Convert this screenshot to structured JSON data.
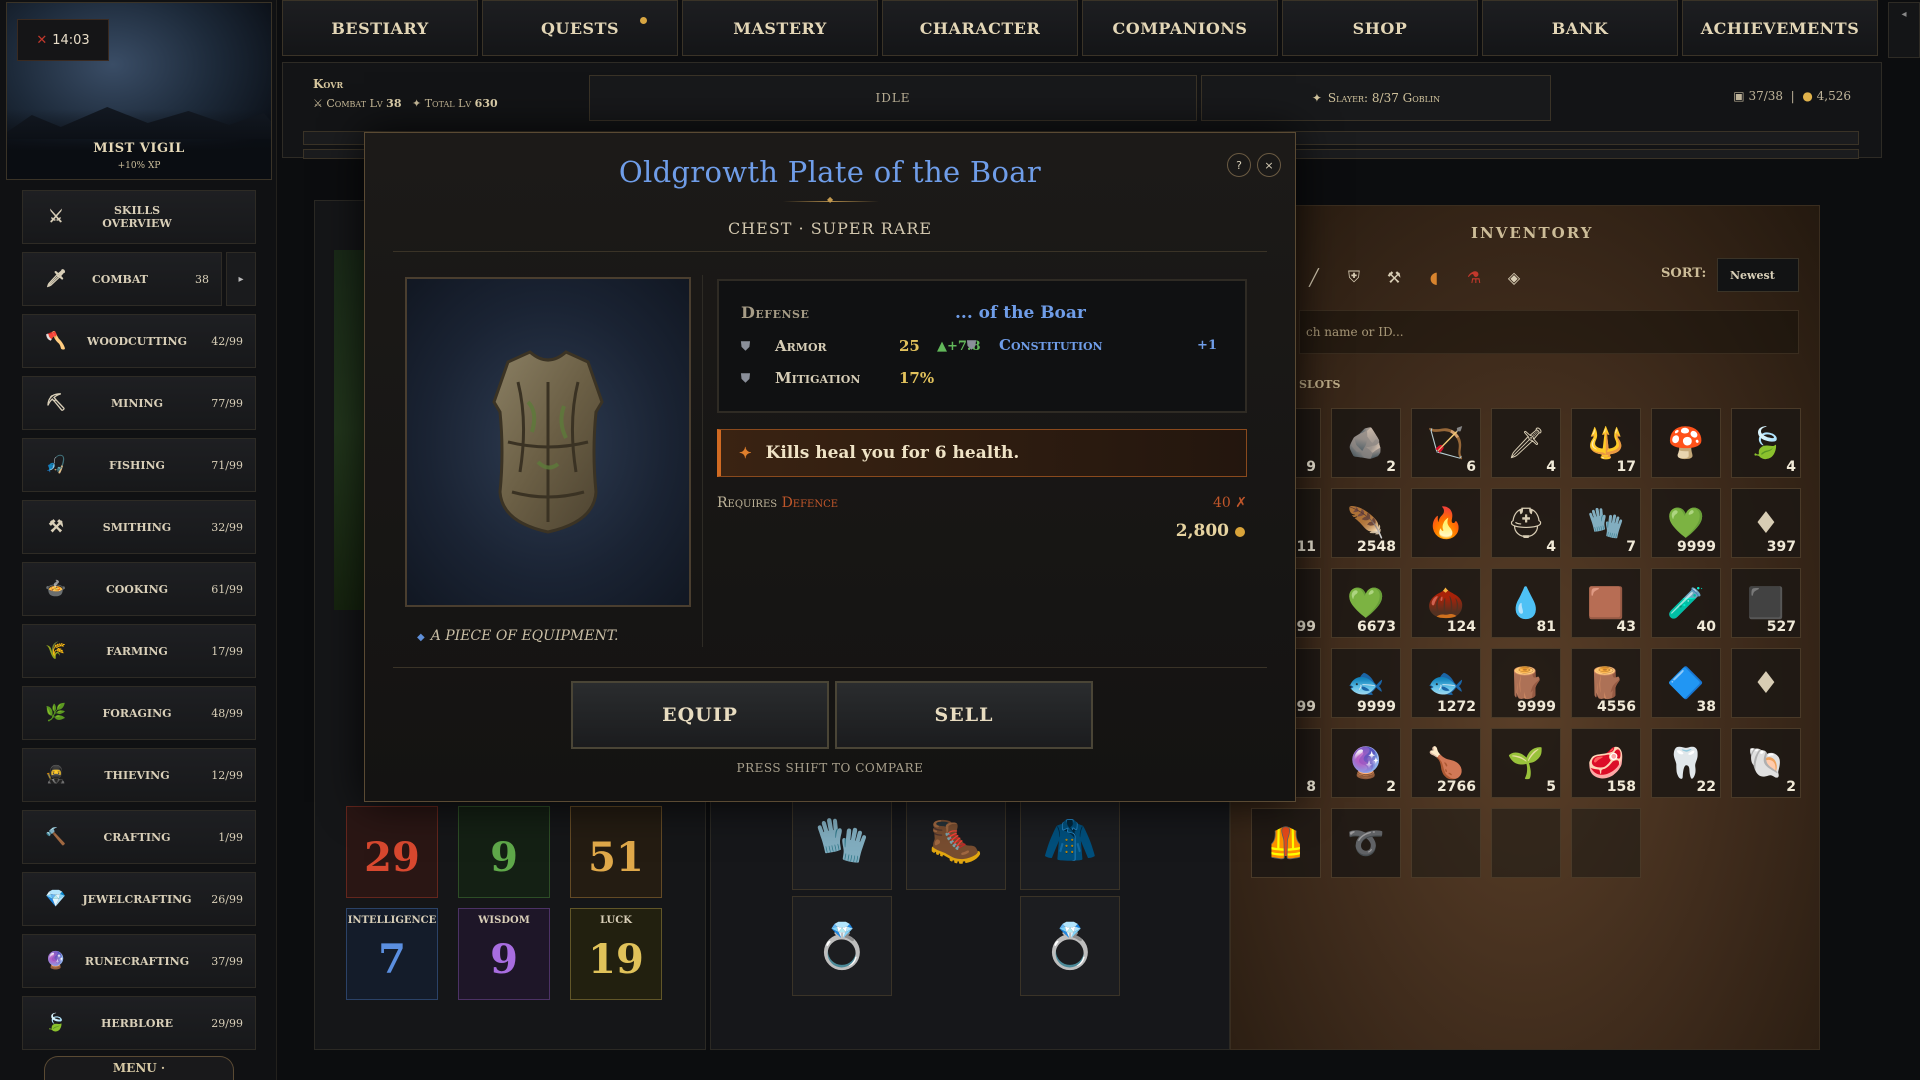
{
  "timer": {
    "value": "14:03"
  },
  "banner": {
    "title": "MIST VIGIL",
    "subtitle": "+10% XP"
  },
  "sidebar": {
    "items": [
      {
        "label": "SKILLS OVERVIEW",
        "level": "",
        "icon": "crossed-swords-icon",
        "glyph": "⚔"
      },
      {
        "label": "COMBAT",
        "level": "38",
        "icon": "sword-icon",
        "glyph": "🗡"
      },
      {
        "label": "WOODCUTTING",
        "level": "42/99",
        "icon": "axe-icon",
        "glyph": "🪓"
      },
      {
        "label": "MINING",
        "level": "77/99",
        "icon": "pickaxe-icon",
        "glyph": "⛏"
      },
      {
        "label": "FISHING",
        "level": "71/99",
        "icon": "fish-hook-icon",
        "glyph": "🎣"
      },
      {
        "label": "SMITHING",
        "level": "32/99",
        "icon": "anvil-icon",
        "glyph": "⚒"
      },
      {
        "label": "COOKING",
        "level": "61/99",
        "icon": "cooking-pot-icon",
        "glyph": "🍲"
      },
      {
        "label": "FARMING",
        "level": "17/99",
        "icon": "wheat-icon",
        "glyph": "🌾"
      },
      {
        "label": "FORAGING",
        "level": "48/99",
        "icon": "herb-icon",
        "glyph": "🌿"
      },
      {
        "label": "THIEVING",
        "level": "12/99",
        "icon": "hood-icon",
        "glyph": "🥷"
      },
      {
        "label": "CRAFTING",
        "level": "1/99",
        "icon": "hammer-icon",
        "glyph": "🔨"
      },
      {
        "label": "JEWELCRAFTING",
        "level": "26/99",
        "icon": "gem-icon",
        "glyph": "💎"
      },
      {
        "label": "RUNECRAFTING",
        "level": "37/99",
        "icon": "rune-icon",
        "glyph": "🔮"
      },
      {
        "label": "HERBLORE",
        "level": "29/99",
        "icon": "leaf-icon",
        "glyph": "🍃"
      }
    ],
    "combat_expand": "▸",
    "menu_label": "MENU ·"
  },
  "nav": {
    "tabs": [
      "BESTIARY",
      "QUESTS",
      "MASTERY",
      "CHARACTER",
      "COMPANIONS",
      "SHOP",
      "BANK",
      "ACHIEVEMENTS"
    ]
  },
  "status": {
    "player_name": "Kovr",
    "combat_label": "Combat Lv",
    "combat_level": "38",
    "total_label": "Total Lv",
    "total_level": "630",
    "activity": "IDLE",
    "slayer": "Slayer: 8/37 Goblin",
    "inv_count": "37/38",
    "gold": "4,526"
  },
  "stats": [
    {
      "label": "",
      "value": "29",
      "color": "#d8482f",
      "bg": "#2a1614"
    },
    {
      "label": "",
      "value": "9",
      "color": "#5fa84a",
      "bg": "#142014"
    },
    {
      "label": "",
      "value": "51",
      "color": "#e0a94a",
      "bg": "#241c12"
    },
    {
      "label": "INTELLIGENCE",
      "value": "7",
      "color": "#5b8fe0",
      "bg": "#141c2a"
    },
    {
      "label": "WISDOM",
      "value": "9",
      "color": "#a86de0",
      "bg": "#1e1628"
    },
    {
      "label": "LUCK",
      "value": "19",
      "color": "#e0c25a",
      "bg": "#22200f"
    }
  ],
  "inventory": {
    "title": "INVENTORY",
    "sort_label": "SORT:",
    "sort_value": "Newest",
    "search_placeholder": "ch name or ID...",
    "slots_label": "SLOTS",
    "items": [
      {
        "qty": "9",
        "icon": "partial-item-icon",
        "glyph": ""
      },
      {
        "qty": "2",
        "icon": "ore-cluster-icon",
        "glyph": "🪨"
      },
      {
        "qty": "6",
        "icon": "bow-icon",
        "glyph": "🏹"
      },
      {
        "qty": "4",
        "icon": "spear-icon",
        "glyph": "🗡"
      },
      {
        "qty": "17",
        "icon": "trident-icon",
        "glyph": "🔱"
      },
      {
        "qty": "",
        "icon": "mushroom-icon",
        "glyph": "🍄"
      },
      {
        "qty": "4",
        "icon": "leaf-blade-icon",
        "glyph": "🍃"
      },
      {
        "qty": "11",
        "icon": "partial-item-icon",
        "glyph": ""
      },
      {
        "qty": "2548",
        "icon": "feather-icon",
        "glyph": "🪶"
      },
      {
        "qty": "",
        "icon": "purple-flame-icon",
        "glyph": "🔥"
      },
      {
        "qty": "4",
        "icon": "helmet-icon",
        "glyph": "⛑"
      },
      {
        "qty": "7",
        "icon": "gloves-icon",
        "glyph": "🧤"
      },
      {
        "qty": "9999",
        "icon": "emerald-ore-icon",
        "glyph": "💚"
      },
      {
        "qty": "397",
        "icon": "ruby-icon",
        "glyph": "♦"
      },
      {
        "qty": "99",
        "icon": "partial-item-icon",
        "glyph": ""
      },
      {
        "qty": "6673",
        "icon": "green-crystal-icon",
        "glyph": "💚"
      },
      {
        "qty": "124",
        "icon": "pinecone-icon",
        "glyph": "🌰"
      },
      {
        "qty": "81",
        "icon": "blue-flame-icon",
        "glyph": "💧"
      },
      {
        "qty": "43",
        "icon": "leather-icon",
        "glyph": "🟫"
      },
      {
        "qty": "40",
        "icon": "red-potion-icon",
        "glyph": "🧪"
      },
      {
        "qty": "527",
        "icon": "coal-icon",
        "glyph": "⬛"
      },
      {
        "qty": "99",
        "icon": "partial-item-icon",
        "glyph": ""
      },
      {
        "qty": "9999",
        "icon": "fish-icon",
        "glyph": "🐟"
      },
      {
        "qty": "1272",
        "icon": "fish-icon",
        "glyph": "🐟"
      },
      {
        "qty": "9999",
        "icon": "log-icon",
        "glyph": "🪵"
      },
      {
        "qty": "4556",
        "icon": "log-icon",
        "glyph": "🪵"
      },
      {
        "qty": "38",
        "icon": "silver-ore-icon",
        "glyph": "🔷"
      },
      {
        "qty": "",
        "icon": "ruby-icon",
        "glyph": "♦"
      },
      {
        "qty": "8",
        "icon": "partial-item-icon",
        "glyph": ""
      },
      {
        "qty": "2",
        "icon": "purple-crystal-icon",
        "glyph": "🔮"
      },
      {
        "qty": "2766",
        "icon": "roast-meat-icon",
        "glyph": "🍗"
      },
      {
        "qty": "5",
        "icon": "seed-pile-icon",
        "glyph": "🌱"
      },
      {
        "qty": "158",
        "icon": "steak-icon",
        "glyph": "🥩"
      },
      {
        "qty": "22",
        "icon": "fang-icon",
        "glyph": "🦷"
      },
      {
        "qty": "2",
        "icon": "shell-icon",
        "glyph": "🐚"
      },
      {
        "qty": "",
        "icon": "chest-armor-icon",
        "glyph": "🦺"
      },
      {
        "qty": "",
        "icon": "whip-icon",
        "glyph": "➰"
      },
      {
        "qty": "",
        "icon": "",
        "glyph": ""
      },
      {
        "qty": "",
        "icon": "",
        "glyph": ""
      },
      {
        "qty": "",
        "icon": "",
        "glyph": ""
      }
    ]
  },
  "equipment": [
    {
      "name": "gauntlets-slot",
      "icon": "gauntlets-icon",
      "glyph": "🧤"
    },
    {
      "name": "boots-slot",
      "icon": "boots-icon",
      "glyph": "🥾"
    },
    {
      "name": "cape-slot",
      "icon": "cape-icon",
      "glyph": "🧥"
    },
    {
      "name": "ring-slot-1",
      "icon": "gold-ring-icon",
      "glyph": "💍"
    },
    {
      "name": "ring-slot-2",
      "icon": "ruby-ring-icon",
      "glyph": "💍"
    }
  ],
  "modal": {
    "title": "Oldgrowth Plate of the Boar",
    "subtitle": "CHEST · SUPER RARE",
    "help_label": "?",
    "close_label": "×",
    "description": "A PIECE OF EQUIPMENT.",
    "defense_header": "Defense",
    "suffix_header": "... of the Boar",
    "stats": [
      {
        "name": "Armor",
        "value": "25",
        "delta": "▲+7.8"
      },
      {
        "name": "Mitigation",
        "value": "17%",
        "delta": ""
      }
    ],
    "bonus": {
      "name": "Constitution",
      "value": "+1"
    },
    "effect": "Kills heal you for 6 health.",
    "requires_label": "Requires",
    "requires_skill": "Defence",
    "requires_value": "40 ✗",
    "price": "2,800",
    "equip_label": "EQUIP",
    "sell_label": "SELL",
    "hint": "PRESS SHIFT TO COMPARE"
  },
  "colors": {
    "accent_blue": "#6f9de8",
    "gold": "#e0b24b",
    "effect_orange": "#d06a22"
  }
}
